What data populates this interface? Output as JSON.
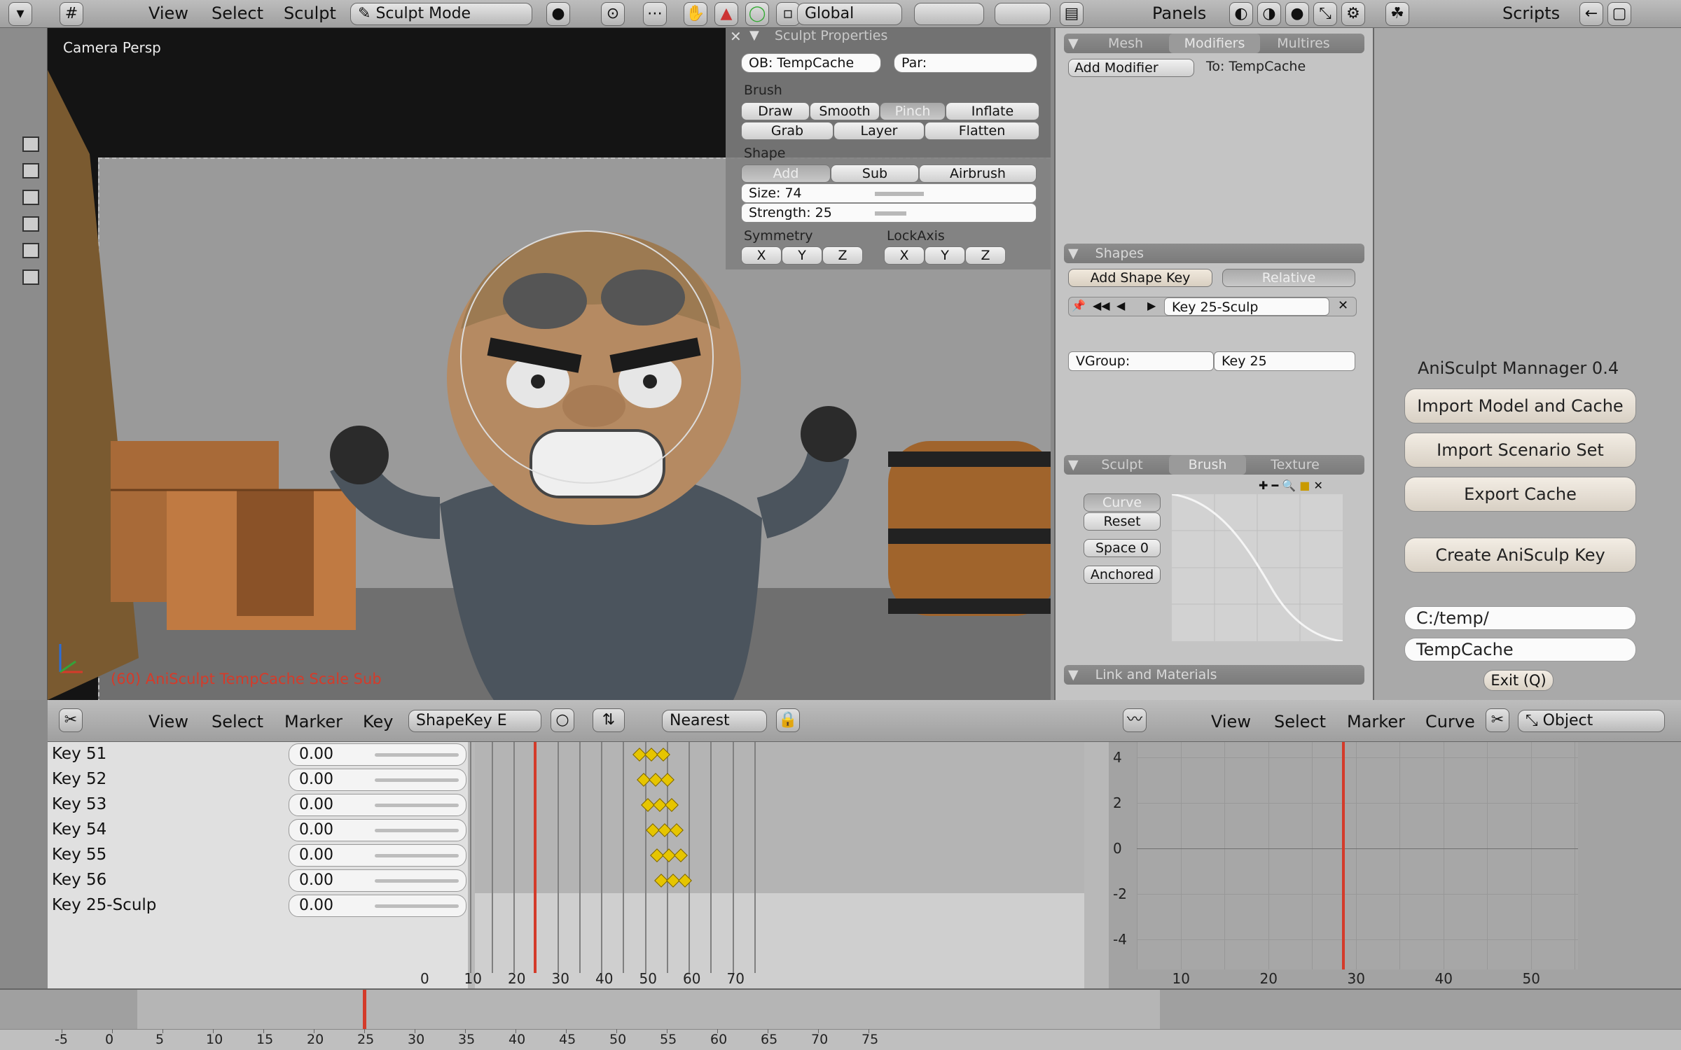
{
  "colors": {
    "accent": "#d43b2a",
    "keyframe": "#e6c500"
  },
  "top_header": {
    "menus": [
      "View",
      "Select",
      "Sculpt"
    ],
    "mode": "Sculpt Mode",
    "orientation": "Global",
    "panels_label": "Panels",
    "scripts_label": "Scripts"
  },
  "viewport": {
    "label": "Camera Persp",
    "status_text": "(60) AniSculpt  TempCache  Scale Sub"
  },
  "sculpt_properties": {
    "title": "Sculpt Properties",
    "ob_field": "OB: TempCache",
    "par_field": "Par:",
    "brush_label": "Brush",
    "brush_buttons": [
      "Draw",
      "Smooth",
      "Pinch",
      "Inflate",
      "Grab",
      "Layer",
      "Flatten"
    ],
    "brush_active": "Pinch",
    "shape_label": "Shape",
    "shape_buttons": [
      "Add",
      "Sub",
      "Airbrush"
    ],
    "shape_active": "Add",
    "size": "Size: 74",
    "size_value": 74,
    "strength": "Strength: 25",
    "strength_value": 25,
    "symmetry_label": "Symmetry",
    "lockaxis_label": "LockAxis",
    "axes": [
      "X",
      "Y",
      "Z"
    ]
  },
  "buttons_window": {
    "tabs": [
      "Mesh",
      "Modifiers",
      "Multires"
    ],
    "active_tab": "Modifiers",
    "add_modifier": "Add Modifier",
    "to_label": "To: TempCache",
    "shapes_title": "Shapes",
    "add_shape_key": "Add Shape Key",
    "relative": "Relative",
    "shape_key_name": "Key 25-Sculp",
    "vgroup": "VGroup:",
    "key_ref": "Key 25",
    "sculpt_tabs": [
      "Sculpt",
      "Brush",
      "Texture"
    ],
    "sculpt_active": "Brush",
    "curve": "Curve",
    "reset": "Reset",
    "space": "Space 0",
    "anchored": "Anchored",
    "link_materials": "Link and Materials"
  },
  "script_panel": {
    "title": "AniSculpt Mannager  0.4",
    "buttons": [
      "Import Model and Cache",
      "Import Scenario Set",
      "Export Cache",
      "Create AniSculp Key"
    ],
    "path": "C:/temp/",
    "cache_name": "TempCache",
    "exit": "Exit (Q)"
  },
  "action_editor": {
    "menus": [
      "View",
      "Select",
      "Marker",
      "Key"
    ],
    "channel_select": "ShapeKey E",
    "interp": "Nearest",
    "keys": [
      {
        "name": "Key 51",
        "value": "0.00",
        "frame": 51
      },
      {
        "name": "Key 52",
        "value": "0.00",
        "frame": 52
      },
      {
        "name": "Key 53",
        "value": "0.00",
        "frame": 53
      },
      {
        "name": "Key 54",
        "value": "0.00",
        "frame": 54
      },
      {
        "name": "Key 55",
        "value": "0.00",
        "frame": 55
      },
      {
        "name": "Key 56",
        "value": "0.00",
        "frame": 56
      },
      {
        "name": "Key 25-Sculp",
        "value": "0.00"
      }
    ],
    "ticks": [
      "0",
      "10",
      "20",
      "30",
      "40",
      "50",
      "60",
      "70"
    ],
    "current_frame": 25
  },
  "ipo_editor": {
    "menus": [
      "View",
      "Select",
      "Marker",
      "Curve"
    ],
    "object": "Object",
    "y_ticks": [
      "4",
      "2",
      "0",
      "-2",
      "-4"
    ],
    "x_ticks": [
      "10",
      "20",
      "30",
      "40",
      "50"
    ]
  },
  "timeline": {
    "ticks": [
      "-5",
      "0",
      "5",
      "10",
      "15",
      "20",
      "25",
      "30",
      "35",
      "40",
      "45",
      "50",
      "55",
      "60",
      "65",
      "70",
      "75"
    ],
    "current_frame": 25
  }
}
